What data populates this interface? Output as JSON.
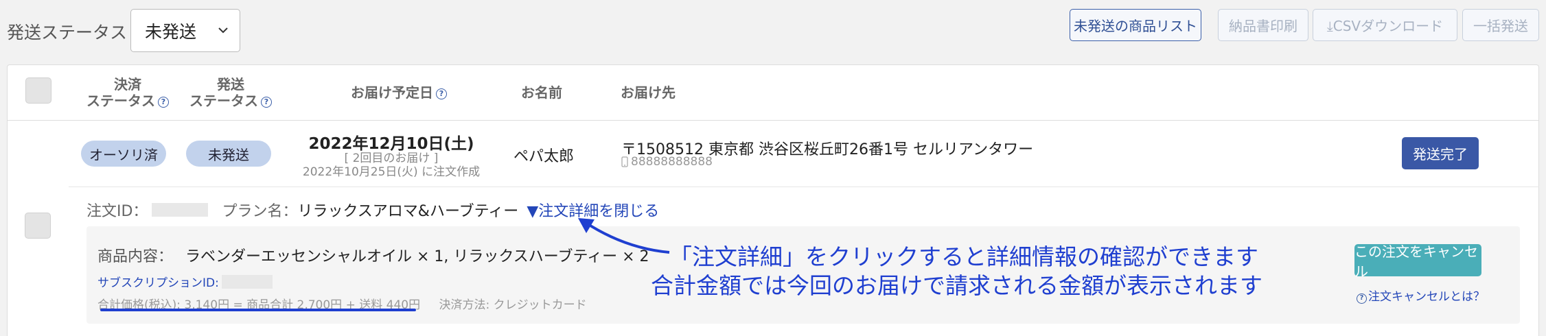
{
  "filter": {
    "label": "発送ステータス",
    "selected": "未発送"
  },
  "toolbar": {
    "unshipped_list": "未発送の商品リスト",
    "print_slip": "納品書印刷",
    "csv_download": "⤓CSVダウンロード",
    "bulk_ship": "一括発送"
  },
  "table": {
    "headers": {
      "payment_status_1": "決済",
      "payment_status_2": "ステータス",
      "shipping_status_1": "発送",
      "shipping_status_2": "ステータス",
      "delivery_date": "お届け予定日",
      "name": "お名前",
      "address": "お届け先"
    }
  },
  "order": {
    "payment_status": "オーソリ済",
    "shipping_status": "未発送",
    "delivery_date": "2022年12月10日(土)",
    "delivery_count": "[ 2回目のお届け ]",
    "created": "2022年10月25日(火) に注文作成",
    "customer_name": "ペパ太郎",
    "address": "〒1508512 東京都 渋谷区桜丘町26番1号 セルリアンタワー",
    "phone": "88888888888",
    "ship_done_button": "発送完了",
    "order_id_label": "注文ID：",
    "plan_label": "プラン名：",
    "plan_name": "リラックスアロマ&ハーブティー",
    "toggle_detail": "▼注文詳細を閉じる"
  },
  "detail": {
    "content_label": "商品内容：",
    "content_value": "ラベンダーエッセンシャルオイル × 1, リラックスハーブティー × 2",
    "subscription_label": "サブスクリプションID:",
    "total": "合計価格(税込): 3,140円 = 商品合計 2,700円 + 送料 440円",
    "payment_method": "決済方法: クレジットカード",
    "cancel_button": "この注文をキャンセル",
    "cancel_help": "注文キャンセルとは？"
  },
  "annotation": {
    "line1": "「注文詳細」をクリックすると詳細情報の確認ができます",
    "line2": "合計金額では今回のお届けで請求される金額が表示されます"
  },
  "colors": {
    "accent": "#3a58a6",
    "annotation": "#1f3fd0",
    "cancel": "#4aaeb8",
    "pill": "#c2d2ec"
  }
}
